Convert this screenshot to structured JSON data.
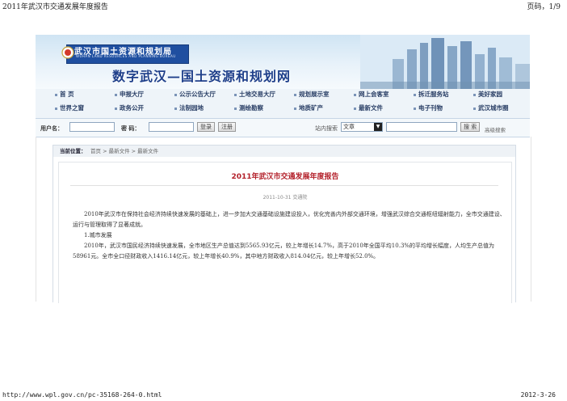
{
  "print_header": {
    "title": "2011年武汉市交通发展年度报告",
    "page": "页码，1/9"
  },
  "banner": {
    "logo_title": "武汉市国土资源和规划局",
    "logo_subtitle": "WUHAN LAND RESOURCES AND PLANNING BUREAU",
    "big_title": "数字武汉—国土资源和规划网"
  },
  "nav": {
    "row1": [
      "首 页",
      "申报大厅",
      "公示公告大厅",
      "土地交易大厅",
      "规划展示室",
      "网上会客室",
      "拆迁服务站",
      "美好家园"
    ],
    "row2": [
      "世界之窗",
      "政务公开",
      "法制园地",
      "测绘勘察",
      "地质矿产",
      "最新文件",
      "电子刊物",
      "武汉城市圈"
    ]
  },
  "login": {
    "username_label": "用户名：",
    "password_label": "密  码：",
    "login_button": "登录",
    "register_button": "注册",
    "search_label": "站内搜索",
    "search_scope": "文章",
    "search_button": "搜 索",
    "advanced_search": "高级搜索"
  },
  "breadcrumb": {
    "current_label": "当前位置：",
    "path": "首页 > 最新文件 > 最新文件"
  },
  "article": {
    "title": "2011年武汉市交通发展年度报告",
    "meta": "2011-10-31  交通院",
    "para1": "2010年武汉市在保持社会经济持续快速发展的基础上，进一步加大交通基础设施建设投入，优化完善内外部交通环境，增强武汉综合交通枢纽辐射能力，全市交通建设、运行与管理取得了显著成就。",
    "para2": "1.城市发展",
    "para3": "2010年，武汉市国民经济持续快速发展，全市地区生产总值达到5565.93亿元，较上年增长14.7%，高于2010年全国平均10.3%的平均增长幅度，人均生产总值为58961元。全市全口径财政收入1416.14亿元，较上年增长40.9%，其中地方财政收入814.04亿元，较上年增长52.0%。"
  },
  "print_footer": {
    "url": "http://www.wpl.gov.cn/pc-35168-264-0.html",
    "date": "2012-3-26"
  }
}
